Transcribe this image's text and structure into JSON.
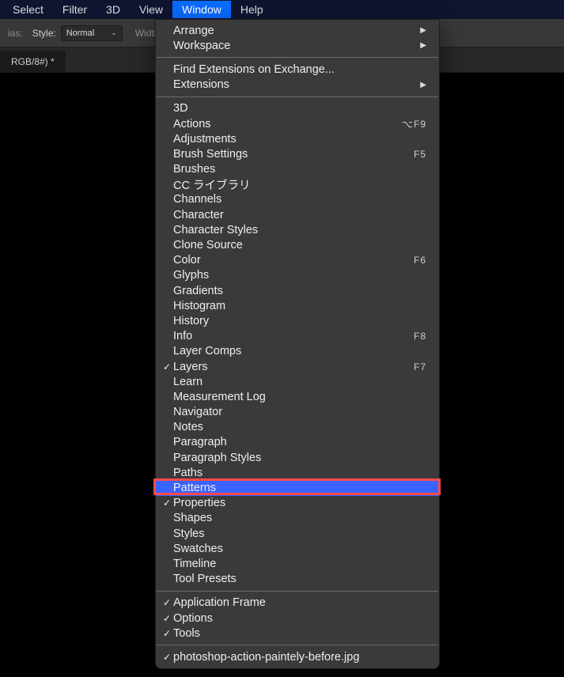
{
  "menubar": {
    "items": [
      {
        "label": "Select"
      },
      {
        "label": "Filter"
      },
      {
        "label": "3D"
      },
      {
        "label": "View"
      },
      {
        "label": "Window",
        "active": true
      },
      {
        "label": "Help"
      }
    ]
  },
  "optionsbar": {
    "ias_label": "ias:",
    "style_label": "Style:",
    "style_value": "Normal",
    "width_label": "Width:"
  },
  "doc_tab": {
    "title": "RGB/8#) *"
  },
  "window_menu": {
    "groups": [
      [
        {
          "label": "Arrange",
          "submenu": true
        },
        {
          "label": "Workspace",
          "submenu": true
        }
      ],
      [
        {
          "label": "Find Extensions on Exchange..."
        },
        {
          "label": "Extensions",
          "submenu": true
        }
      ],
      [
        {
          "label": "3D"
        },
        {
          "label": "Actions",
          "shortcut": "⌥F9"
        },
        {
          "label": "Adjustments"
        },
        {
          "label": "Brush Settings",
          "shortcut": "F5"
        },
        {
          "label": "Brushes"
        },
        {
          "label": "CC ライブラリ"
        },
        {
          "label": "Channels"
        },
        {
          "label": "Character"
        },
        {
          "label": "Character Styles"
        },
        {
          "label": "Clone Source"
        },
        {
          "label": "Color",
          "shortcut": "F6"
        },
        {
          "label": "Glyphs"
        },
        {
          "label": "Gradients"
        },
        {
          "label": "Histogram"
        },
        {
          "label": "History"
        },
        {
          "label": "Info",
          "shortcut": "F8"
        },
        {
          "label": "Layer Comps"
        },
        {
          "label": "Layers",
          "checked": true,
          "shortcut": "F7"
        },
        {
          "label": "Learn"
        },
        {
          "label": "Measurement Log"
        },
        {
          "label": "Navigator"
        },
        {
          "label": "Notes"
        },
        {
          "label": "Paragraph"
        },
        {
          "label": "Paragraph Styles"
        },
        {
          "label": "Paths"
        },
        {
          "label": "Patterns",
          "highlighted": true
        },
        {
          "label": "Properties",
          "checked": true
        },
        {
          "label": "Shapes"
        },
        {
          "label": "Styles"
        },
        {
          "label": "Swatches"
        },
        {
          "label": "Timeline"
        },
        {
          "label": "Tool Presets"
        }
      ],
      [
        {
          "label": "Application Frame",
          "checked": true
        },
        {
          "label": "Options",
          "checked": true
        },
        {
          "label": "Tools",
          "checked": true
        }
      ],
      [
        {
          "label": "photoshop-action-paintely-before.jpg",
          "checked": true
        }
      ]
    ]
  }
}
